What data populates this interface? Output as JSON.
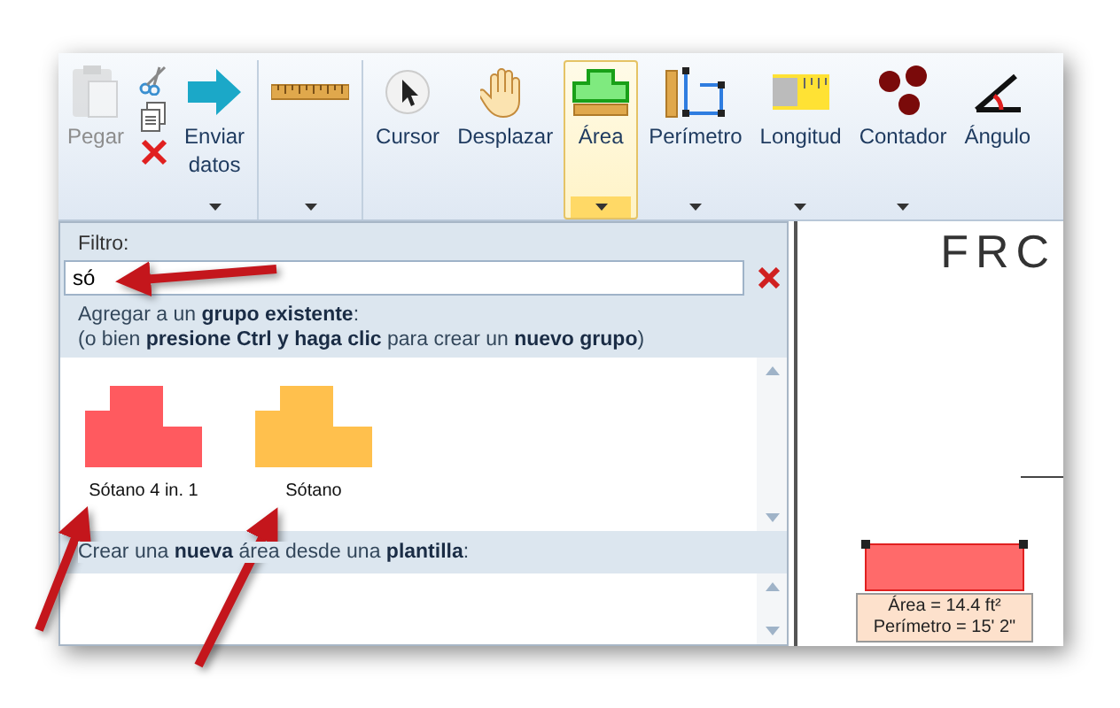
{
  "ribbon": {
    "groups": [
      {
        "tools": [
          {
            "label": "Pegar",
            "disabled": true,
            "selected": false,
            "dropdown": false
          },
          {
            "label": "Enviar datos",
            "disabled": false,
            "selected": false,
            "dropdown": true
          }
        ]
      },
      {
        "tools": [
          {
            "disabled": false,
            "selected": false,
            "dropdown": true
          }
        ]
      },
      {
        "tools": [
          {
            "label": "Cursor",
            "disabled": false,
            "selected": false,
            "dropdown": false
          },
          {
            "label": "Desplazar",
            "disabled": false,
            "selected": false,
            "dropdown": false
          },
          {
            "label": "Área",
            "disabled": false,
            "selected": true,
            "dropdown": true
          },
          {
            "label": "Perímetro",
            "disabled": false,
            "selected": false,
            "dropdown": true
          },
          {
            "label": "Longitud",
            "disabled": false,
            "selected": false,
            "dropdown": true
          },
          {
            "label": "Contador",
            "disabled": false,
            "selected": false,
            "dropdown": true
          },
          {
            "label": "Ángulo",
            "disabled": false,
            "selected": false,
            "dropdown": false
          }
        ]
      }
    ]
  },
  "panel": {
    "filter_label": "Filtro:",
    "filter_value": "só",
    "existing_heading": "Agregar a un **grupo existente**:",
    "existing_hint": "(o bien **presione Ctrl y haga clic** para crear un **nuevo grupo**)",
    "groups": [
      {
        "name": "Sótano 4 in. 1",
        "color": "#ff5a5f"
      },
      {
        "name": "Sótano",
        "color": "#ffc04d"
      }
    ],
    "template_heading": "Crear una **nueva** área desde una **plantilla**:"
  },
  "canvas": {
    "title": "FRC",
    "measurement": [
      "Área = 14.4 ft²",
      "Perímetro = 15' 2\""
    ]
  }
}
